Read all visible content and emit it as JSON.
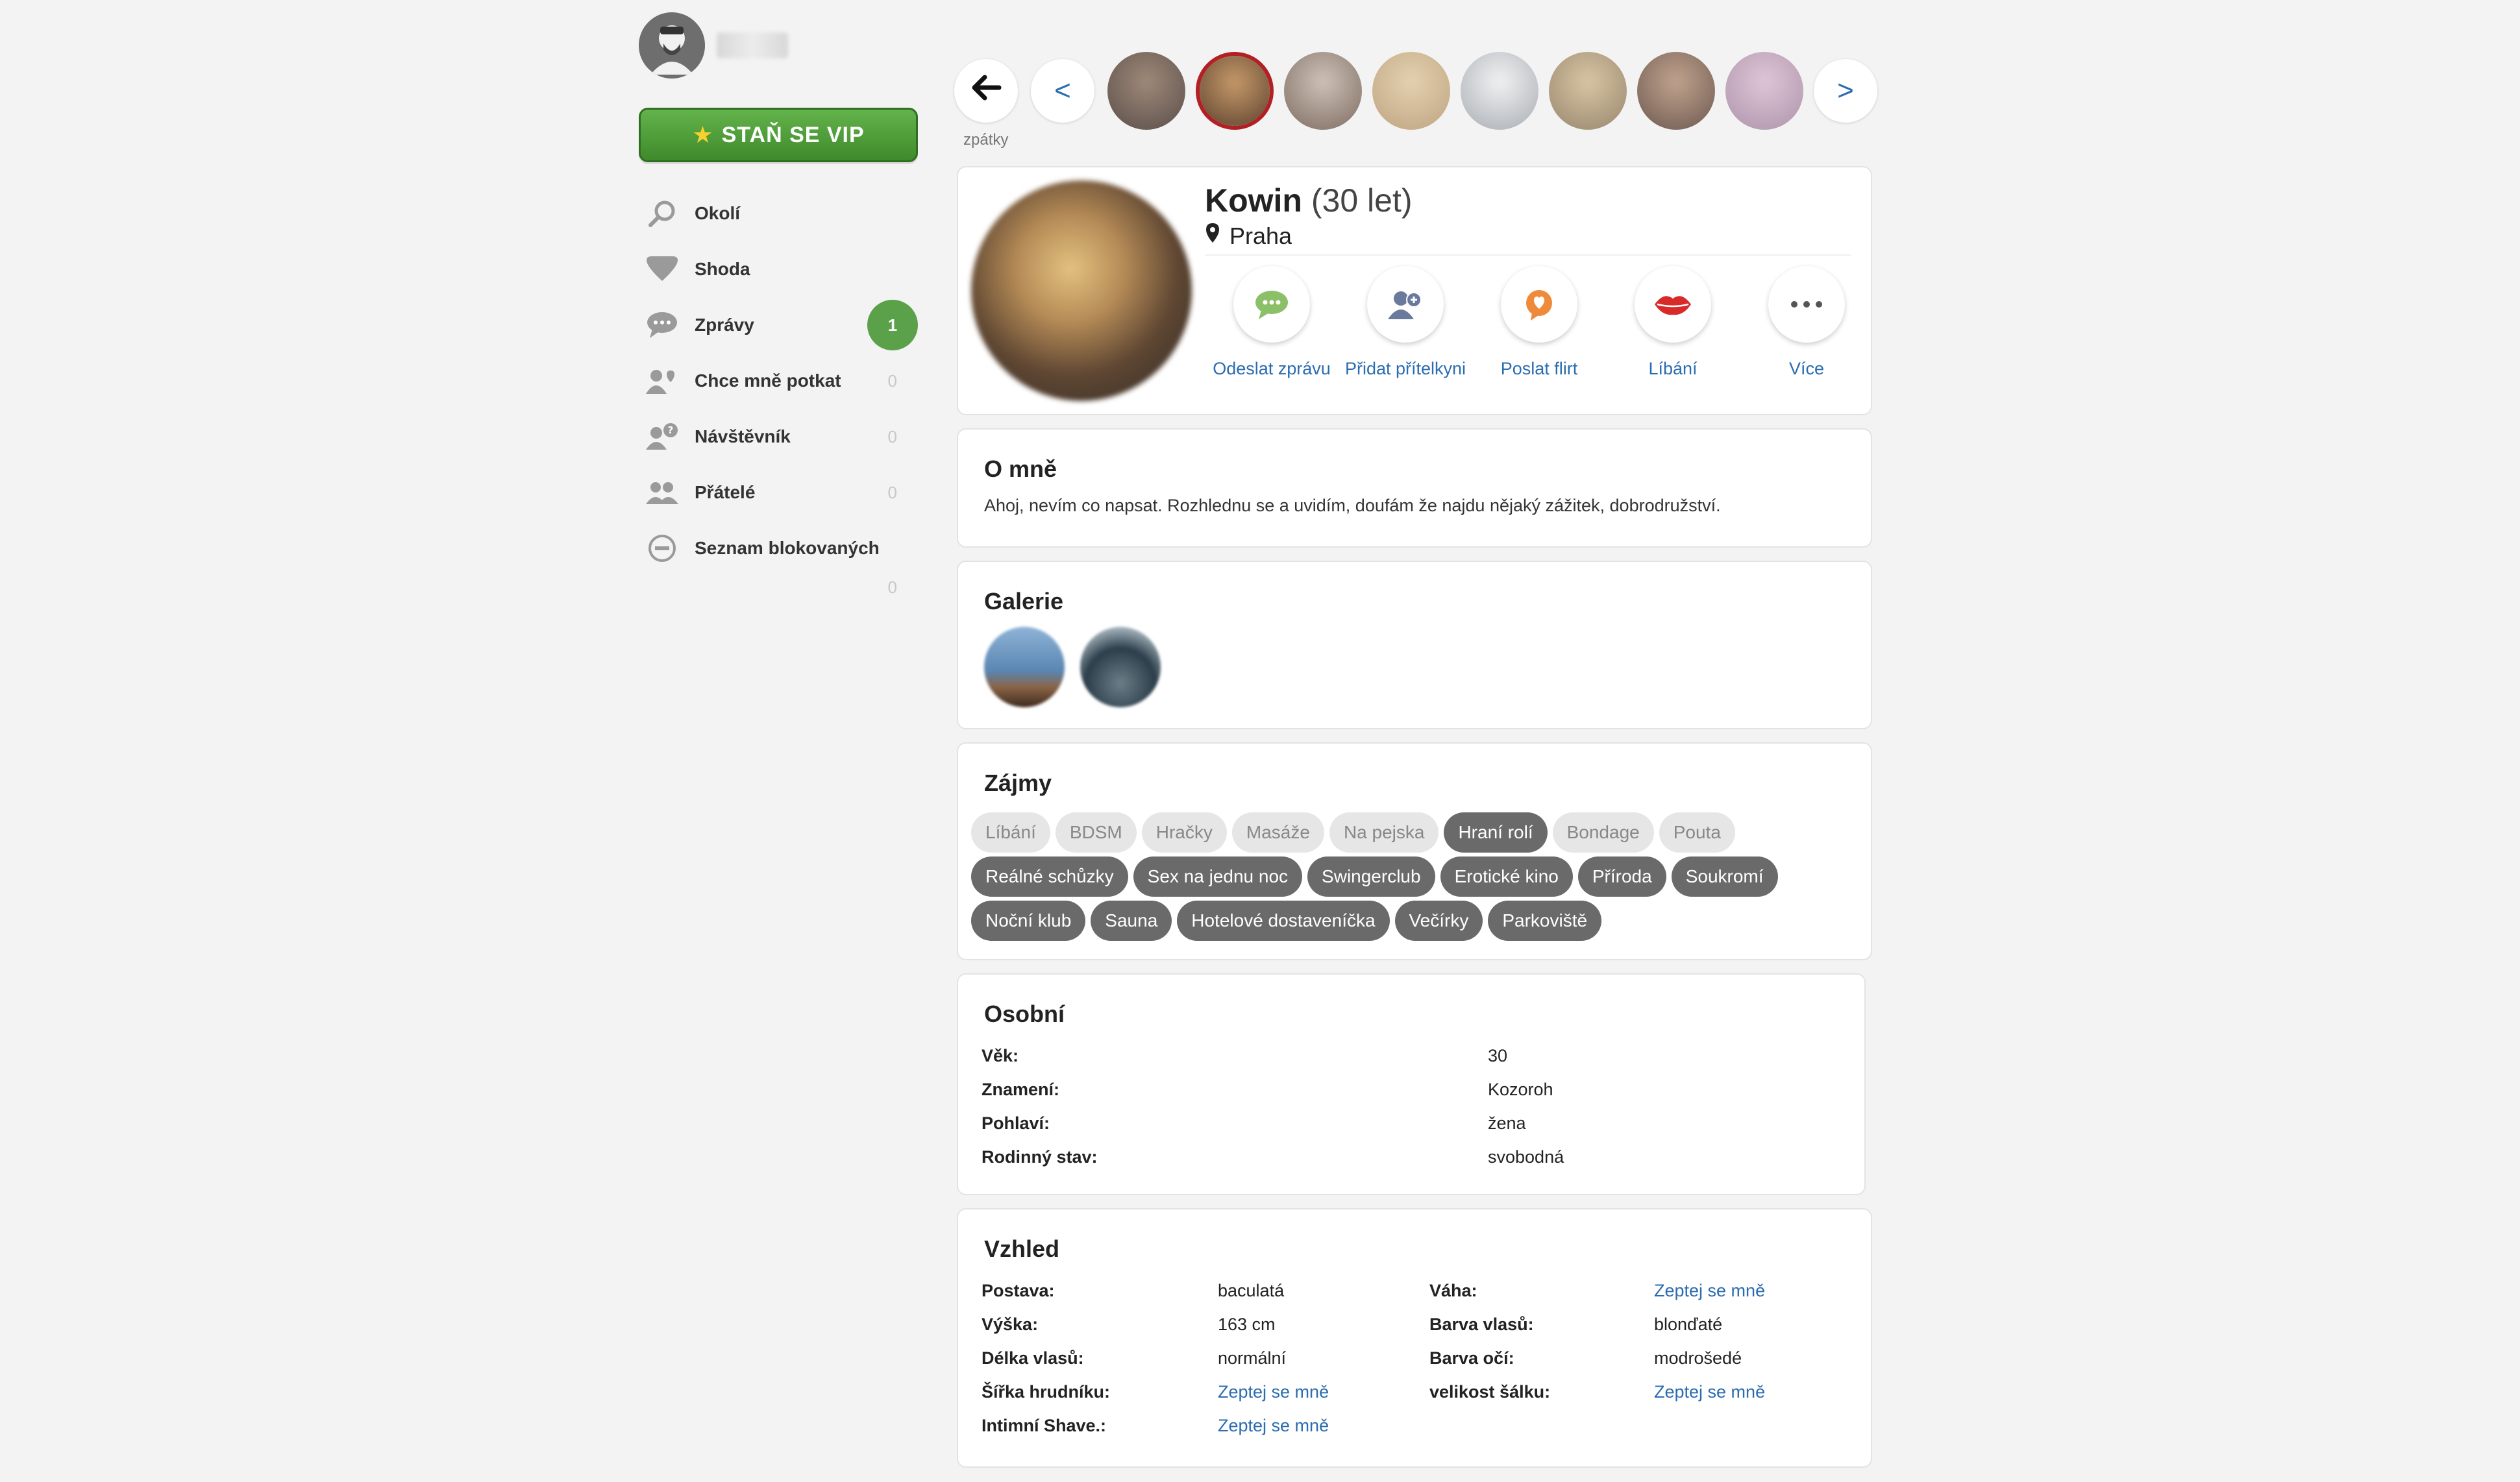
{
  "sidebar": {
    "vip_label": "STAŇ SE VIP",
    "items": [
      {
        "label": "Okolí",
        "icon": "search-icon"
      },
      {
        "label": "Shoda",
        "icon": "heart-icon"
      },
      {
        "label": "Zprávy",
        "icon": "chat-icon",
        "badge": "1"
      },
      {
        "label": "Chce mně potkat",
        "icon": "users-heart-icon",
        "count": "0"
      },
      {
        "label": "Návštěvník",
        "icon": "user-question-icon",
        "count": "0"
      },
      {
        "label": "Přátelé",
        "icon": "friends-icon",
        "count": "0"
      },
      {
        "label": "Seznam blokovaných",
        "icon": "block-icon"
      }
    ],
    "extra_count": "0"
  },
  "carousel": {
    "back_label": "zpátky",
    "prev": "<",
    "next": ">"
  },
  "profile": {
    "name": "Kowin",
    "age": "(30 let)",
    "city": "Praha",
    "actions": [
      {
        "label": "Odeslat zprávu",
        "icon": "message-icon"
      },
      {
        "label": "Přidat přítelkyni",
        "icon": "add-friend-icon"
      },
      {
        "label": "Poslat flirt",
        "icon": "flirt-icon"
      },
      {
        "label": "Líbání",
        "icon": "kiss-icon"
      },
      {
        "label": "Více",
        "icon": "more-icon"
      }
    ]
  },
  "about": {
    "title": "O mně",
    "text": "Ahoj, nevím co napsat. Rozhlednu se a uvidím, doufám že najdu nějaký zážitek, dobrodružství."
  },
  "gallery": {
    "title": "Galerie"
  },
  "interests": {
    "title": "Zájmy",
    "tags": [
      {
        "label": "Líbání",
        "active": false
      },
      {
        "label": "BDSM",
        "active": false
      },
      {
        "label": "Hračky",
        "active": false
      },
      {
        "label": "Masáže",
        "active": false
      },
      {
        "label": "Na pejska",
        "active": false
      },
      {
        "label": "Hraní rolí",
        "active": true
      },
      {
        "label": "Bondage",
        "active": false
      },
      {
        "label": "Pouta",
        "active": false
      },
      {
        "label": "Reálné schůzky",
        "active": true
      },
      {
        "label": "Sex na jednu noc",
        "active": true
      },
      {
        "label": "Swingerclub",
        "active": true
      },
      {
        "label": "Erotické kino",
        "active": true
      },
      {
        "label": "Příroda",
        "active": true
      },
      {
        "label": "Soukromí",
        "active": true
      },
      {
        "label": "Noční klub",
        "active": true
      },
      {
        "label": "Sauna",
        "active": true
      },
      {
        "label": "Hotelové dostaveníčka",
        "active": true
      },
      {
        "label": "Večírky",
        "active": true
      },
      {
        "label": "Parkoviště",
        "active": true
      }
    ]
  },
  "personal": {
    "title": "Osobní",
    "rows": [
      {
        "key": "Věk:",
        "value": "30"
      },
      {
        "key": "Znamení:",
        "value": "Kozoroh"
      },
      {
        "key": "Pohlaví:",
        "value": "žena"
      },
      {
        "key": "Rodinný stav:",
        "value": "svobodná"
      }
    ]
  },
  "look": {
    "title": "Vzhled",
    "left": [
      {
        "key": "Postava:",
        "value": "baculatá",
        "link": false
      },
      {
        "key": "Výška:",
        "value": "163 cm",
        "link": false
      },
      {
        "key": "Délka vlasů:",
        "value": "normální",
        "link": false
      },
      {
        "key": "Šířka hrudníku:",
        "value": "Zeptej se mně",
        "link": true
      },
      {
        "key": "Intimní Shave.:",
        "value": "Zeptej se mně",
        "link": true
      }
    ],
    "right": [
      {
        "key": "Váha:",
        "value": "Zeptej se mně",
        "link": true
      },
      {
        "key": "Barva vlasů:",
        "value": "blonďaté",
        "link": false
      },
      {
        "key": "Barva očí:",
        "value": "modrošedé",
        "link": false
      },
      {
        "key": "velikost šálku:",
        "value": "Zeptej se mně",
        "link": true
      }
    ]
  }
}
